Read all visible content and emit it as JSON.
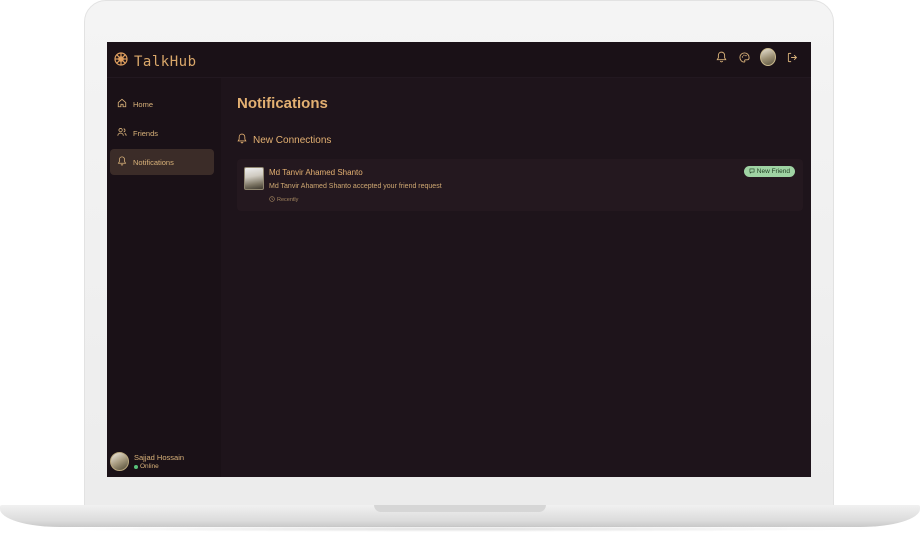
{
  "app": {
    "name": "TalkHub"
  },
  "sidebar": {
    "items": [
      {
        "label": "Home",
        "icon": "home-icon",
        "active": false
      },
      {
        "label": "Friends",
        "icon": "users-icon",
        "active": false
      },
      {
        "label": "Notifications",
        "icon": "bell-icon",
        "active": true
      }
    ],
    "user": {
      "name": "Sajjad Hossain",
      "status": "Online"
    }
  },
  "header": {
    "icons": [
      "bell-icon",
      "palette-icon",
      "avatar",
      "logout-icon"
    ]
  },
  "main": {
    "title": "Notifications",
    "section": {
      "title": "New Connections",
      "icon": "bell-icon"
    },
    "notifications": [
      {
        "name": "Md Tanvir Ahamed Shanto",
        "message": "Md Tanvir Ahamed Shanto accepted your friend request",
        "time": "Recently",
        "badge": "New Friend"
      }
    ]
  },
  "colors": {
    "accent": "#e3b072",
    "background": "#1e141b",
    "sidebar": "#1a1117",
    "badge": "#9fd3a3",
    "online": "#58c27a"
  }
}
